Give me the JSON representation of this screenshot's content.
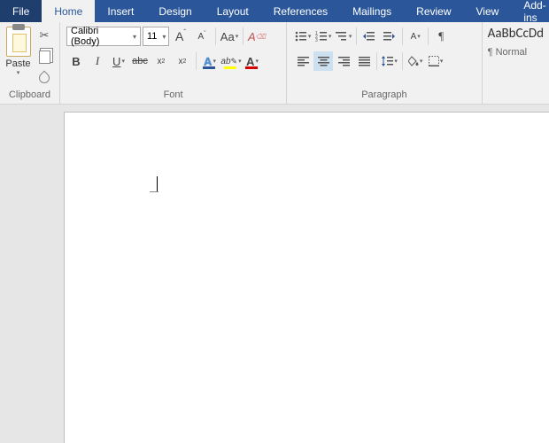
{
  "tabs": {
    "file": "File",
    "home": "Home",
    "insert": "Insert",
    "design": "Design",
    "layout": "Layout",
    "references": "References",
    "mailings": "Mailings",
    "review": "Review",
    "view": "View",
    "addins": "Add-ins"
  },
  "clipboard": {
    "label": "Clipboard",
    "paste": "Paste"
  },
  "font": {
    "label": "Font",
    "family": "Calibri (Body)",
    "size": "11",
    "grow": "A",
    "shrink": "A",
    "case": "Aa",
    "bold": "B",
    "italic": "I",
    "underline": "U",
    "strike": "abc",
    "sub": "x",
    "sup": "x",
    "effects": "A",
    "highlight": "ab",
    "color": "A"
  },
  "paragraph": {
    "label": "Paragraph"
  },
  "styles": {
    "preview": "AaBbCcDd",
    "name": "¶ Normal"
  }
}
